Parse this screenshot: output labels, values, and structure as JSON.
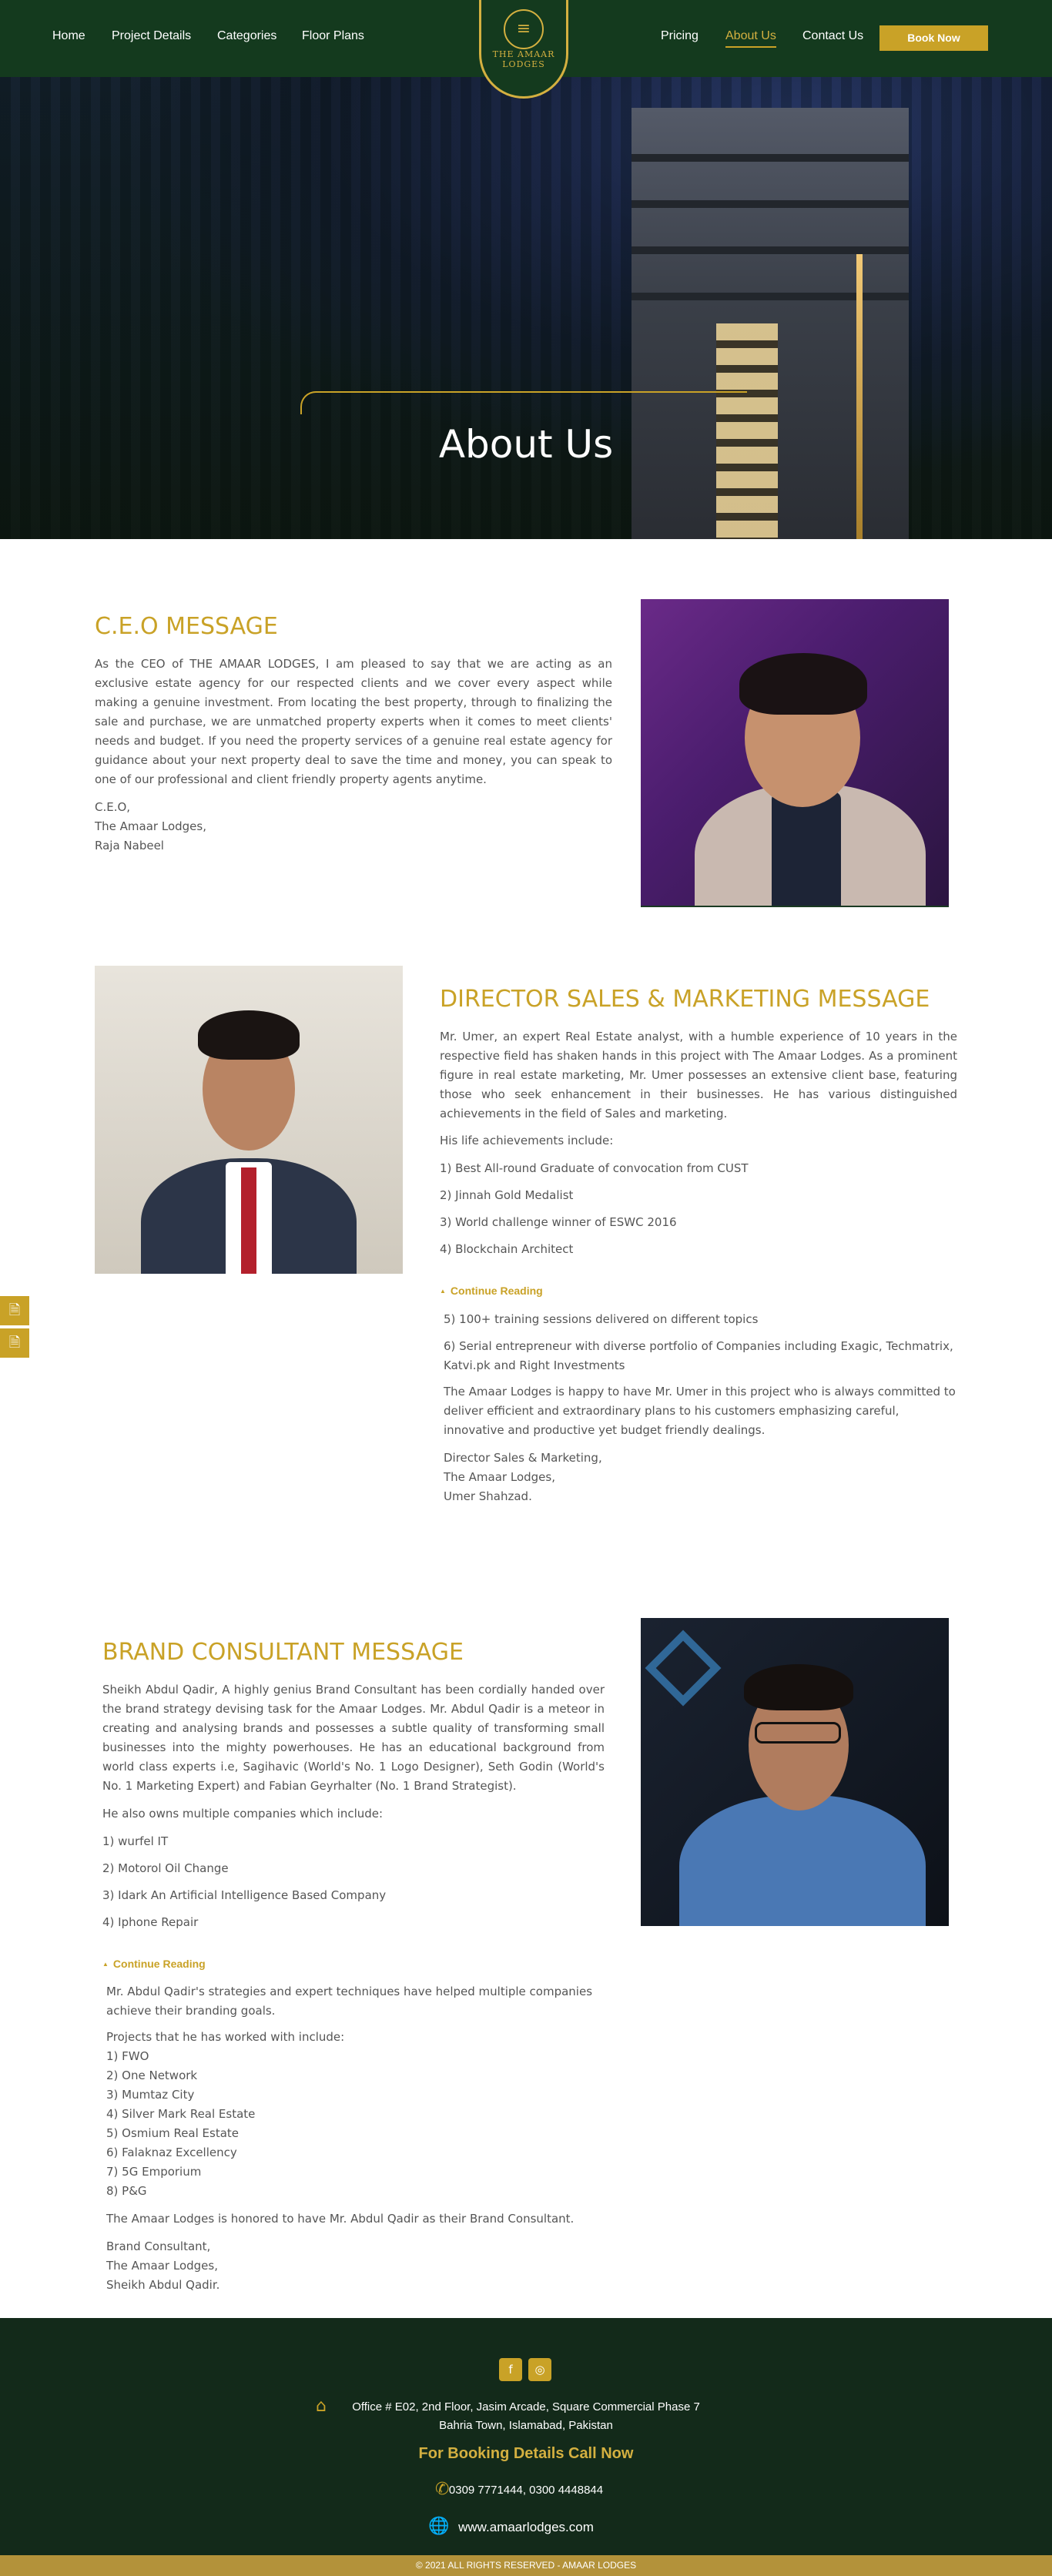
{
  "nav": {
    "home": "Home",
    "project_details": "Project Details",
    "categories": "Categories",
    "floor_plans": "Floor Plans",
    "pricing": "Pricing",
    "about_us": "About Us",
    "contact_us": "Contact Us",
    "book_now": "Book Now",
    "logo_line1": "THE AMAAR",
    "logo_line2": "LODGES"
  },
  "hero": {
    "title": "About Us"
  },
  "ceo": {
    "title": "C.E.O MESSAGE",
    "body": "As the CEO of THE AMAAR LODGES, I am pleased to say that we are acting as an exclusive estate agency for our respected clients and we cover every aspect while making a genuine investment. From locating the best property, through to finalizing the sale and purchase, we are unmatched property experts when it comes to meet clients' needs and budget. If you need the property services of a genuine real estate agency for guidance about your next property deal to save the time and money, you can speak to one of our professional and client friendly property agents anytime.",
    "sign1": "C.E.O,",
    "sign2": "The Amaar Lodges,",
    "sign3": "Raja Nabeel"
  },
  "director": {
    "title": "DIRECTOR SALES & MARKETING MESSAGE",
    "body": "Mr. Umer, an expert Real Estate analyst, with a humble experience of 10 years in the respective field has shaken hands in this project with The Amaar Lodges. As a prominent figure in real estate marketing, Mr. Umer possesses an extensive client base, featuring those who seek enhancement in their businesses. He has various distinguished achievements in the field of Sales and marketing.",
    "intro": "His life achievements include:",
    "achievements": [
      "1) Best All-round Graduate of convocation from CUST",
      "2) Jinnah Gold Medalist",
      "3) World challenge winner of ESWC 2016",
      "4) Blockchain Architect"
    ],
    "continue": "Continue Reading",
    "more5": "5) 100+ training sessions delivered on different topics",
    "more6": "6) Serial entrepreneur with diverse portfolio of Companies including Exagic, Techmatrix, Katvi.pk and Right Investments",
    "closing": "The Amaar Lodges is happy to have Mr. Umer in this project who is always committed to deliver efficient and extraordinary plans to his customers emphasizing careful, innovative and productive yet budget friendly dealings.",
    "sign1": "Director Sales & Marketing,",
    "sign2": "The Amaar Lodges,",
    "sign3": "Umer Shahzad."
  },
  "brand": {
    "title": "BRAND CONSULTANT MESSAGE",
    "body": "Sheikh Abdul Qadir, A highly genius Brand Consultant has been cordially handed over the brand strategy devising task for the Amaar Lodges. Mr. Abdul Qadir is a meteor in creating and analysing brands and possesses a subtle quality of transforming small businesses into the mighty powerhouses. He has an educational background from world class experts i.e, Sagihavic (World's No. 1 Logo Designer), Seth Godin (World's No. 1 Marketing Expert) and Fabian Geyrhalter (No. 1 Brand Strategist).",
    "intro": "He also owns multiple companies which include:",
    "companies": [
      "1) wurfel IT",
      "2) Motorol Oil Change",
      "3) Idark An Artificial Intelligence Based Company",
      "4) Iphone Repair"
    ],
    "continue": "Continue Reading",
    "strategies": "Mr. Abdul Qadir's strategies and expert techniques have helped multiple companies achieve their branding goals.",
    "projects_intro": "Projects that he has worked with include:",
    "projects": [
      "1) FWO",
      "2) One Network",
      "3) Mumtaz City",
      "4) Silver Mark Real Estate",
      "5) Osmium Real Estate",
      "6) Falaknaz Excellency",
      "7) 5G Emporium",
      "8) P&G"
    ],
    "honored": "The Amaar Lodges is honored  to have Mr. Abdul Qadir as their Brand Consultant.",
    "sign1": "Brand Consultant,",
    "sign2": "The Amaar Lodges,",
    "sign3": "Sheikh Abdul Qadir."
  },
  "footer": {
    "address1": "Office # E02, 2nd Floor, Jasim Arcade, Square Commercial Phase 7",
    "address2": "Bahria Town, Islamabad, Pakistan",
    "call_heading": "For Booking Details Call Now",
    "phones": "0309 7771444, 0300 4448844",
    "website": "www.amaarlodges.com",
    "copyright": "© 2021 ALL RIGHTS RESERVED - AMAAR LODGES"
  },
  "colors": {
    "brand_green": "#143a1e",
    "accent_gold": "#c9a227"
  },
  "icons": [
    "facebook-icon",
    "instagram-icon",
    "home-icon",
    "phone-icon",
    "globe-icon",
    "pdf-icon"
  ]
}
